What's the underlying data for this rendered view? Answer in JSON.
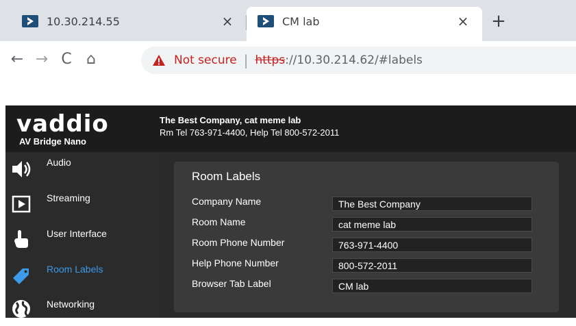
{
  "browser": {
    "tabs": [
      {
        "title": "10.30.214.55",
        "close": "×"
      },
      {
        "title": "CM lab",
        "close": "×"
      }
    ],
    "new_tab": "+",
    "nav": {
      "back": "←",
      "forward": "→",
      "reload": "C",
      "home": "⌂"
    },
    "security_label": "Not secure",
    "separator": "|",
    "url_scheme": "https",
    "url_rest": "://10.30.214.62/#labels",
    "colors": {
      "tabstrip": "#dee1e6",
      "warning": "#c5221f"
    }
  },
  "header": {
    "brand": "vaddio",
    "product": "AV Bridge Nano",
    "company_line": "The Best Company, cat meme lab",
    "phone_line": "Rm Tel 763-971-4400, Help Tel 800-572-2011"
  },
  "sidebar": {
    "items": [
      {
        "label": "Audio",
        "icon": "speaker-icon"
      },
      {
        "label": "Streaming",
        "icon": "play-icon"
      },
      {
        "label": "User Interface",
        "icon": "pointing-hand-icon"
      },
      {
        "label": "Room Labels",
        "icon": "tag-icon",
        "active": true
      },
      {
        "label": "Networking",
        "icon": "globe-icon"
      }
    ]
  },
  "panel": {
    "title": "Room Labels",
    "fields": [
      {
        "label": "Company Name",
        "value": "The Best Company"
      },
      {
        "label": "Room Name",
        "value": "cat meme lab"
      },
      {
        "label": "Room Phone Number",
        "value": "763-971-4400"
      },
      {
        "label": "Help Phone Number",
        "value": "800-572-2011"
      },
      {
        "label": "Browser Tab Label",
        "value": "CM lab"
      }
    ]
  },
  "colors": {
    "accent": "#3d9be9",
    "favicon": "#1f4e79"
  }
}
